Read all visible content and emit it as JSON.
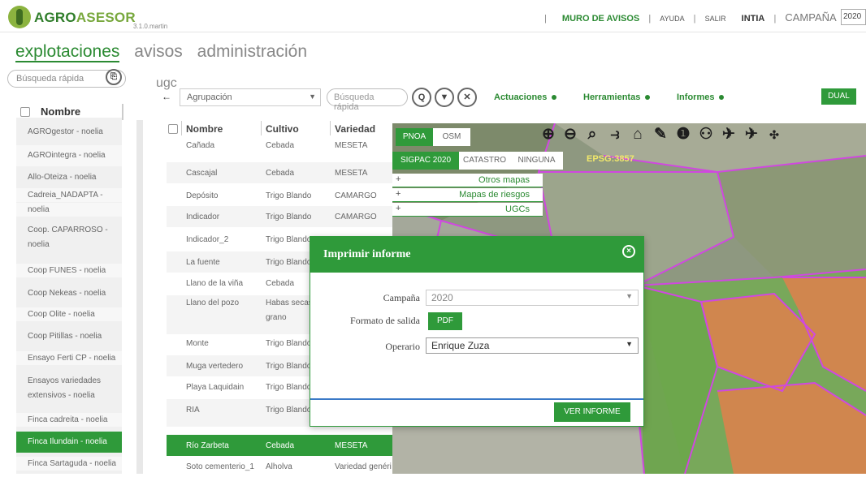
{
  "header": {
    "brand_strong": "AGRO",
    "brand_rest": "ASESOR",
    "version": "3.1.0.martin",
    "muro": "MURO DE AVISOS",
    "ayuda": "AYUDA",
    "salir": "SALIR",
    "intia": "INTIA",
    "campana_label": "CAMPAÑA",
    "campana_value": "2020",
    "separator": "|"
  },
  "nav": {
    "tabs": [
      "explotaciones",
      "avisos",
      "administración"
    ]
  },
  "left": {
    "search_placeholder": "Búsqueda rápida",
    "header": "Nombre",
    "items": [
      "AGROgestor - noelia",
      "AGROintegra - noelia",
      "Allo-Oteiza - noelia",
      "Cadreia_NADAPTA -",
      "noelia",
      "Coop. CAPARROSO -",
      "noelia",
      "Coop FUNES - noelia",
      "Coop Nekeas - noelia",
      "Coop Olite - noelia",
      "Coop Pitillas - noelia",
      "Ensayo Ferti CP - noelia",
      "Ensayos variedades",
      "extensivos - noelia",
      "Finca cadreita - noelia",
      "Finca Ilundain - noelia",
      "Finca Sartaguda - noelia"
    ]
  },
  "ugc": {
    "title": "ugc",
    "back": "←",
    "agrupacion": "Agrupación",
    "search_placeholder": "Búsqueda rápida",
    "actuaciones": "Actuaciones",
    "herramientas": "Herramientas",
    "informes": "Informes",
    "dual": "DUAL"
  },
  "table": {
    "headers": [
      "Nombre",
      "Cultivo",
      "Variedad"
    ],
    "rows": [
      {
        "nombre": "Cañada",
        "cultivo": "Cebada",
        "variedad": "MESETA"
      },
      {
        "nombre": "Cascajal",
        "cultivo": "Cebada",
        "variedad": "MESETA"
      },
      {
        "nombre": "Depósito",
        "cultivo": "Trigo Blando",
        "variedad": "CAMARGO"
      },
      {
        "nombre": "Indicador",
        "cultivo": "Trigo Blando",
        "variedad": "CAMARGO"
      },
      {
        "nombre": "Indicador_2",
        "cultivo": "Trigo Blando",
        "variedad": ""
      },
      {
        "nombre": "La fuente",
        "cultivo": "Trigo Blando",
        "variedad": ""
      },
      {
        "nombre": "Llano de la viña",
        "cultivo": "Cebada",
        "variedad": ""
      },
      {
        "nombre": "Llano del pozo",
        "cultivo": "Habas secas",
        "variedad": ""
      },
      {
        "nombre": "",
        "cultivo": "grano",
        "variedad": ""
      },
      {
        "nombre": "Monte",
        "cultivo": "Trigo Blando",
        "variedad": ""
      },
      {
        "nombre": "Muga vertedero",
        "cultivo": "Trigo Blando",
        "variedad": ""
      },
      {
        "nombre": "Playa Laquidain",
        "cultivo": "Trigo Blando",
        "variedad": ""
      },
      {
        "nombre": "RIA",
        "cultivo": "Trigo Blando",
        "variedad": ""
      },
      {
        "nombre": "Río Zarbeta",
        "cultivo": "Cebada",
        "variedad": "MESETA"
      },
      {
        "nombre": "Soto cementerio_1",
        "cultivo": "Alholva",
        "variedad": "Variedad genéri"
      }
    ]
  },
  "map": {
    "base_tabs": [
      "PNOA",
      "OSM"
    ],
    "sigpac_tabs": [
      "SIGPAC 2020",
      "CATASTRO",
      "NINGUNA"
    ],
    "epsg": "EPSG:3857",
    "layers": [
      "Otros mapas",
      "Mapas de riesgos",
      "UGCs"
    ],
    "plus": "+",
    "tools": [
      "zoom-in",
      "zoom-out",
      "zoom-extent",
      "measure",
      "home",
      "ruler",
      "info",
      "binoculars",
      "satellite",
      "satellite-info",
      "drone"
    ],
    "colors": {
      "field_green": "#6ca64a",
      "field_orange": "#d9824d",
      "border": "#d048e0"
    }
  },
  "modal": {
    "title": "Imprimir informe",
    "close": "×",
    "campana_label": "Campaña",
    "campana_value": "2020",
    "formato_label": "Formato de salida",
    "formato_value": "PDF",
    "operario_label": "Operario",
    "operario_value": "Enrique Zuza",
    "ver_informe": "VER INFORME"
  },
  "colors": {
    "accent": "#2f9a3a",
    "link": "#2b8a32"
  }
}
